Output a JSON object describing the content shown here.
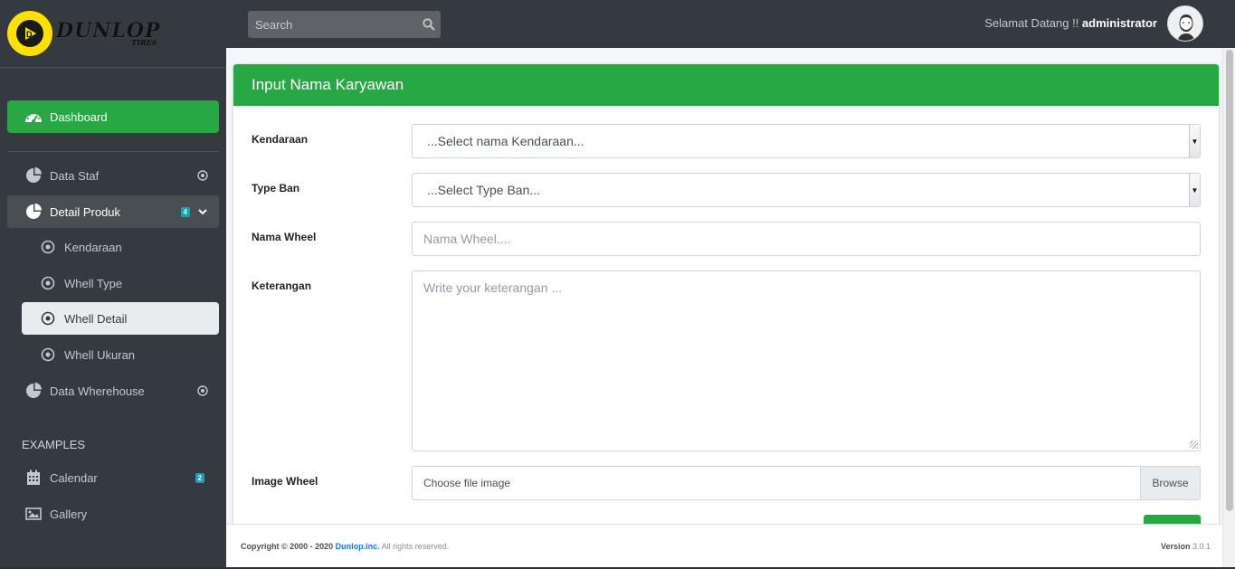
{
  "brand": {
    "name": "DUNLOP",
    "sub": "TIRES"
  },
  "colors": {
    "accent": "#28a745",
    "sidebar": "#343a40",
    "badge": "#17a2b8",
    "link": "#007bff"
  },
  "topbar": {
    "search_placeholder": "Search",
    "welcome_text": "Selamat Datang !! ",
    "username": "administrator"
  },
  "sidebar": {
    "dashboard": {
      "label": "Dashboard",
      "icon": "tachometer-icon"
    },
    "items": [
      {
        "label": "Data Staf",
        "icon": "pie-chart-icon"
      },
      {
        "label": "Detail Produk",
        "icon": "pie-chart-icon",
        "badge": "4"
      },
      {
        "label": "Data Wherehouse",
        "icon": "pie-chart-icon"
      }
    ],
    "sub_items": [
      {
        "label": "Kendaraan"
      },
      {
        "label": "Whell Type"
      },
      {
        "label": "Whell Detail"
      },
      {
        "label": "Whell Ukuran"
      }
    ],
    "examples_header": "EXAMPLES",
    "examples": [
      {
        "label": "Calendar",
        "icon": "calendar-icon",
        "badge": "2"
      },
      {
        "label": "Gallery",
        "icon": "image-icon"
      }
    ]
  },
  "form": {
    "title": "Input Nama Karyawan",
    "fields": {
      "kendaraan": {
        "label": "Kendaraan",
        "value": "...Select nama Kendaraan..."
      },
      "type_ban": {
        "label": "Type Ban",
        "value": "...Select Type Ban..."
      },
      "nama_wheel": {
        "label": "Nama Wheel",
        "placeholder": "Nama Wheel...."
      },
      "keterangan": {
        "label": "Keterangan",
        "placeholder": "Write your keterangan ..."
      },
      "image_wheel": {
        "label": "Image Wheel",
        "file_text": "Choose file image",
        "browse_label": "Browse"
      }
    }
  },
  "footer": {
    "copyright": "Copyright © 2000 - 2020 ",
    "company": "Dunlop.inc.",
    "rights": " All rights reserved.",
    "version_label": "Version",
    "version": "3.0.1"
  }
}
